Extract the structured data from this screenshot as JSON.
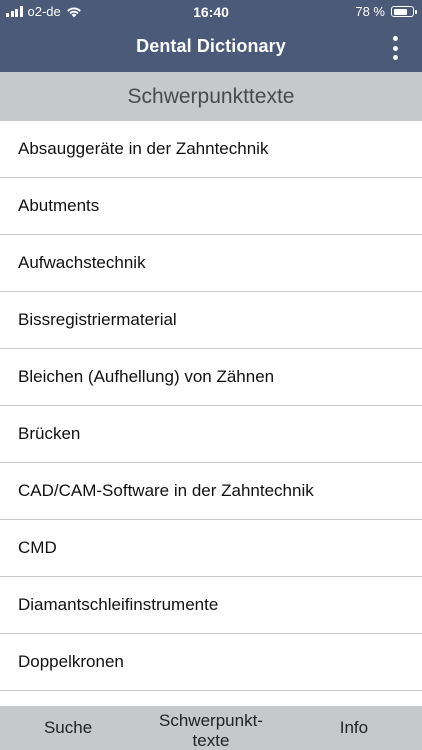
{
  "status_bar": {
    "carrier": "o2-de",
    "time": "16:40",
    "battery_text": "78 %",
    "battery_level": 0.78
  },
  "nav": {
    "title": "Dental Dictionary",
    "menu_icon": "more-vertical-icon"
  },
  "section": {
    "title": "Schwerpunkttexte"
  },
  "list": {
    "items": [
      "Absauggeräte in der Zahntechnik",
      "Abutments",
      "Aufwachstechnik",
      "Bissregistriermaterial",
      "Bleichen (Aufhellung) von Zähnen",
      "Brücken",
      "CAD/CAM-Software in der Zahntechnik",
      "CMD",
      "Diamantschleifinstrumente",
      "Doppelkronen"
    ]
  },
  "tabbar": {
    "search": "Suche",
    "focus_line1": "Schwerpunkt-",
    "focus_line2": "texte",
    "info": "Info"
  },
  "colors": {
    "nav_background": "#4a5a78",
    "section_background": "#c5c9ca",
    "tabbar_background": "#c5c9ca"
  }
}
